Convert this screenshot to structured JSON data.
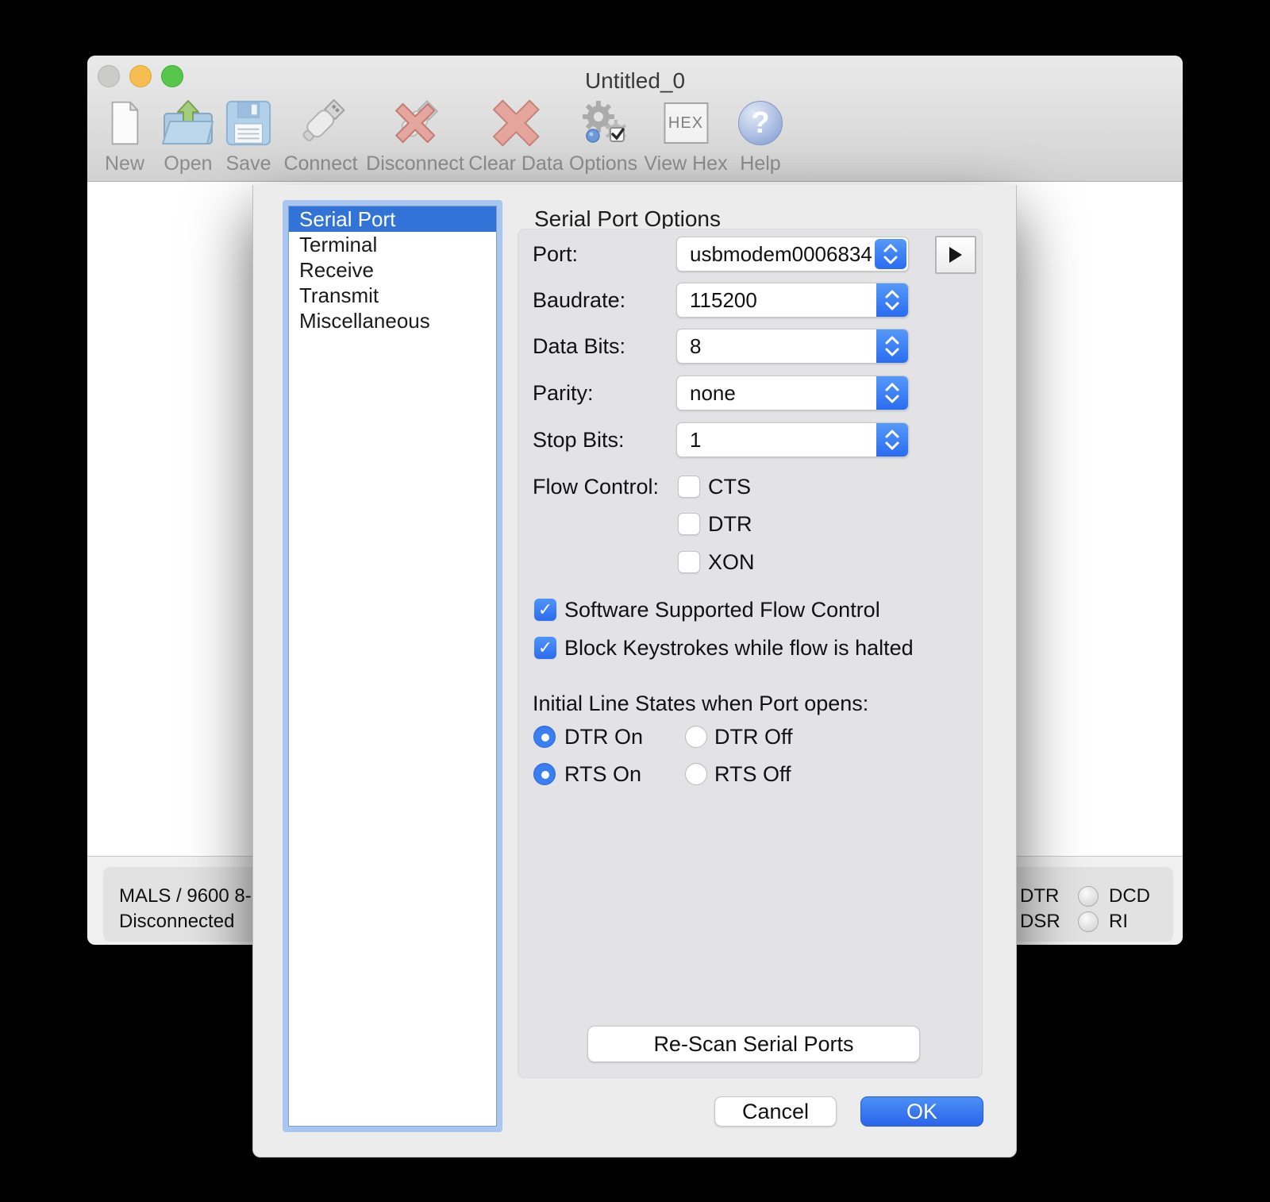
{
  "window": {
    "title": "Untitled_0",
    "toolbar": {
      "items": [
        {
          "label": "New"
        },
        {
          "label": "Open"
        },
        {
          "label": "Save"
        },
        {
          "label": "Connect"
        },
        {
          "label": "Disconnect"
        },
        {
          "label": "Clear Data"
        },
        {
          "label": "Options"
        },
        {
          "label": "View Hex"
        },
        {
          "label": "Help"
        }
      ],
      "hex_badge": "HEX"
    },
    "status_bar": {
      "connection_summary": "MALS / 9600 8-",
      "connection_state": "Disconnected",
      "line_indicators": [
        {
          "label": "DTR"
        },
        {
          "label": "DSR"
        },
        {
          "label": "DCD"
        },
        {
          "label": "RI"
        }
      ]
    }
  },
  "dialog": {
    "sidebar": {
      "items": [
        "Serial Port",
        "Terminal",
        "Receive",
        "Transmit",
        "Miscellaneous"
      ],
      "selected": "Serial Port"
    },
    "section_title": "Serial Port Options",
    "fields": [
      {
        "label": "Port:",
        "value": "usbmodem0006834..."
      },
      {
        "label": "Baudrate:",
        "value": "115200"
      },
      {
        "label": "Data Bits:",
        "value": "8"
      },
      {
        "label": "Parity:",
        "value": "none"
      },
      {
        "label": "Stop Bits:",
        "value": "1"
      }
    ],
    "flow_control": {
      "label": "Flow Control:",
      "options": [
        {
          "label": "CTS",
          "checked": false
        },
        {
          "label": "DTR",
          "checked": false
        },
        {
          "label": "XON",
          "checked": false
        }
      ]
    },
    "software_flow": {
      "label": "Software Supported Flow Control",
      "checked": true
    },
    "block_keystrokes": {
      "label": "Block Keystrokes while flow is halted",
      "checked": true
    },
    "initial_line_states": {
      "label": "Initial Line States when Port opens:",
      "options": [
        {
          "label": "DTR On",
          "selected": true
        },
        {
          "label": "DTR Off",
          "selected": false
        },
        {
          "label": "RTS On",
          "selected": true
        },
        {
          "label": "RTS Off",
          "selected": false
        }
      ]
    },
    "rescan_button_label": "Re-Scan Serial Ports",
    "cancel_label": "Cancel",
    "ok_label": "OK"
  },
  "colors": {
    "selection_blue": "#3273d8",
    "control_blue": "#3b7ef0",
    "focus_ring": "#a9c6f0",
    "ok_top": "#4b90f5",
    "ok_bottom": "#2a64ec",
    "traffic_close_disabled": "#cbcbc9",
    "traffic_minimize": "#f6be50",
    "traffic_zoom": "#57c74b",
    "danger_x": "#e5a49c",
    "dialog_background": "#ececec"
  }
}
